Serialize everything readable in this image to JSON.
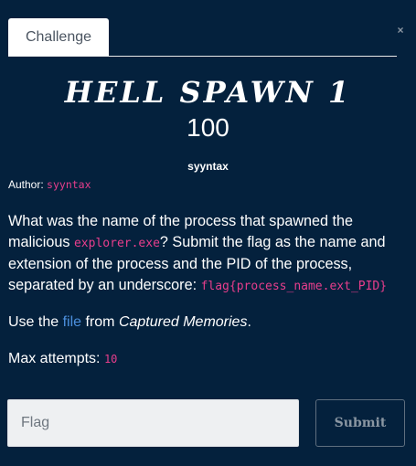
{
  "tabs": [
    {
      "label": "Challenge"
    }
  ],
  "close_icon": "×",
  "challenge": {
    "name": "Hell Spawn 1",
    "value": "100",
    "creator": "syyntax",
    "author_label": "Author:",
    "author": "syyntax",
    "description": {
      "p1": "What was the name of the process that spawned the malicious",
      "code1": "explorer.exe",
      "p2": "? Submit the flag as the name and extension of the process and the PID of the process, separated by an underscore:",
      "code2": "flag{process_name.ext_PID}"
    },
    "use_the": "Use the",
    "file_link": "file",
    "from": "from",
    "source": "Captured Memories",
    "period": ".",
    "max_attempts_label": "Max attempts:",
    "max_attempts": "10"
  },
  "form": {
    "placeholder": "Flag",
    "submit_label": "Submit"
  },
  "colors": {
    "background": "#04213d",
    "code": "#e83e8c",
    "link": "#4b8fdd"
  }
}
